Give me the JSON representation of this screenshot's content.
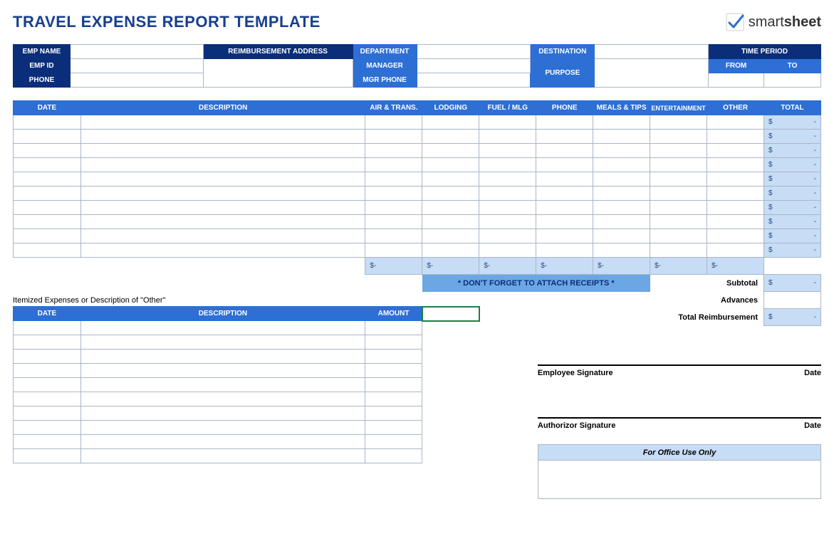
{
  "title": "TRAVEL EXPENSE REPORT TEMPLATE",
  "logo": {
    "brand_left": "smart",
    "brand_right": "sheet"
  },
  "info": {
    "emp_name": "EMP NAME",
    "emp_id": "EMP ID",
    "phone": "PHONE",
    "reimb_addr": "REIMBURSEMENT ADDRESS",
    "department": "DEPARTMENT",
    "manager": "MANAGER",
    "mgr_phone": "MGR PHONE",
    "destination": "DESTINATION",
    "purpose": "PURPOSE",
    "time_period": "TIME PERIOD",
    "from": "FROM",
    "to": "TO"
  },
  "columns": {
    "date": "DATE",
    "description": "DESCRIPTION",
    "air_trans": "AIR & TRANS.",
    "lodging": "LODGING",
    "fuel_mlg": "FUEL / MLG",
    "phone": "PHONE",
    "meals_tips": "MEALS & TIPS",
    "entertainment": "ENTERTAINMENT",
    "other": "OTHER",
    "total": "TOTAL"
  },
  "money": {
    "dollar": "$",
    "dash": "-"
  },
  "reminder": "* DON'T FORGET TO ATTACH RECEIPTS *",
  "summary": {
    "subtotal": "Subtotal",
    "advances": "Advances",
    "total_reimb": "Total Reimbursement"
  },
  "itemized": {
    "caption": "Itemized Expenses or Description of \"Other\"",
    "date": "DATE",
    "description": "DESCRIPTION",
    "amount": "AMOUNT"
  },
  "signatures": {
    "employee": "Employee Signature",
    "authorizor": "Authorizor Signature",
    "date": "Date"
  },
  "office": "For Office Use Only"
}
